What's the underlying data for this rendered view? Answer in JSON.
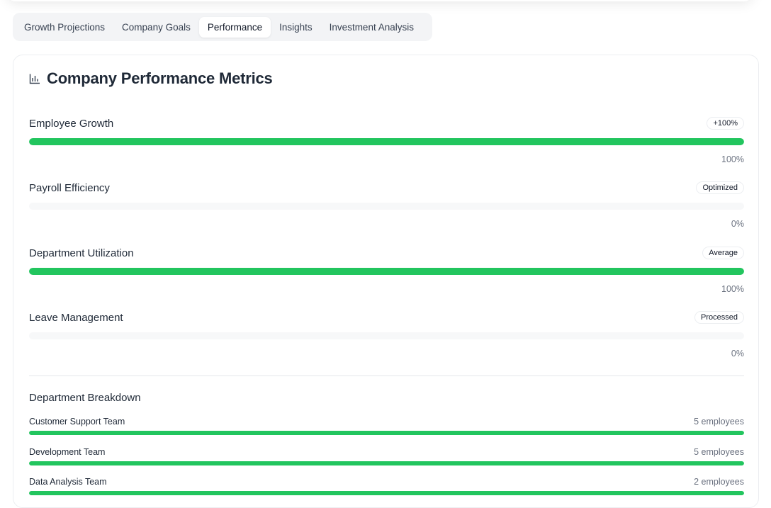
{
  "tabs": [
    {
      "label": "Growth Projections"
    },
    {
      "label": "Company Goals"
    },
    {
      "label": "Performance"
    },
    {
      "label": "Insights"
    },
    {
      "label": "Investment Analysis"
    }
  ],
  "active_tab": "Performance",
  "card": {
    "title": "Company Performance Metrics",
    "title_icon": "bar-chart-icon"
  },
  "metrics": [
    {
      "label": "Employee Growth",
      "badge": "+100%",
      "percent_text": "100%",
      "value": 100
    },
    {
      "label": "Payroll Efficiency",
      "badge": "Optimized",
      "percent_text": "0%",
      "value": 0
    },
    {
      "label": "Department Utilization",
      "badge": "Average",
      "percent_text": "100%",
      "value": 100
    },
    {
      "label": "Leave Management",
      "badge": "Processed",
      "percent_text": "0%",
      "value": 0
    }
  ],
  "breakdown": {
    "title": "Department Breakdown",
    "departments": [
      {
        "name": "Customer Support Team",
        "count": "5 employees",
        "value": 100
      },
      {
        "name": "Development Team",
        "count": "5 employees",
        "value": 100
      },
      {
        "name": "Data Analysis Team",
        "count": "2 employees",
        "value": 100
      }
    ]
  },
  "colors": {
    "accent": "#22c55e",
    "track": "#f7f8f9",
    "text": "#1f2937",
    "muted": "#6b7280"
  }
}
